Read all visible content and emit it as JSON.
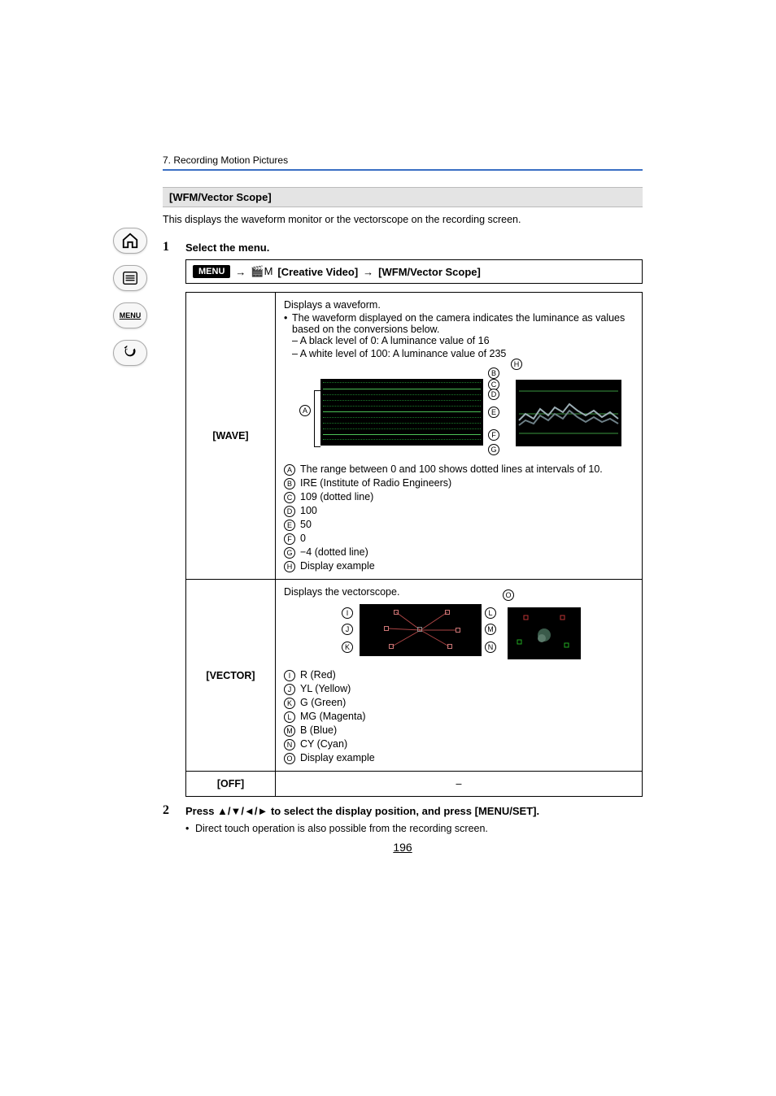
{
  "chapter": "7. Recording Motion Pictures",
  "section_title": "[WFM/Vector Scope]",
  "intro": "This displays the waveform monitor or the vectorscope on the recording screen.",
  "sidebar": {
    "home": "home-icon",
    "toc": "list-icon",
    "menu": "MENU",
    "back": "back-icon"
  },
  "step1": {
    "num": "1",
    "text": "Select the menu."
  },
  "menu_path": {
    "menu_badge": "MENU",
    "arrow1": "→",
    "menu1": "[Creative Video]",
    "arrow2": "→",
    "menu2": "[WFM/Vector Scope]"
  },
  "wave": {
    "name": "[WAVE]",
    "p1": "Displays a waveform.",
    "p2": "The waveform displayed on the camera indicates the luminance as values based on the conversions below.",
    "p3": "– A black level of 0: A luminance value of 16",
    "p4": "– A white level of 100: A luminance value of 235",
    "callouts": {
      "A": "The range between 0 and 100 shows dotted lines at intervals of 10.",
      "B": "IRE (Institute of Radio Engineers)",
      "C": "109 (dotted line)",
      "D": "100",
      "E": "50",
      "F": "0",
      "G": "−4 (dotted line)",
      "H": "Display example"
    }
  },
  "vector": {
    "name": "[VECTOR]",
    "p1": "Displays the vectorscope.",
    "callouts": {
      "I": "R (Red)",
      "J": "YL (Yellow)",
      "K": "G (Green)",
      "L": "MG (Magenta)",
      "M": "B (Blue)",
      "N": "CY (Cyan)",
      "O": "Display example"
    }
  },
  "off": {
    "name": "[OFF]",
    "value": "–"
  },
  "step2": {
    "num": "2",
    "text": "Press ▲/▼/◄/► to select the display position, and press [MENU/SET].",
    "note": "Direct touch operation is also possible from the recording screen."
  },
  "page_number": "196"
}
